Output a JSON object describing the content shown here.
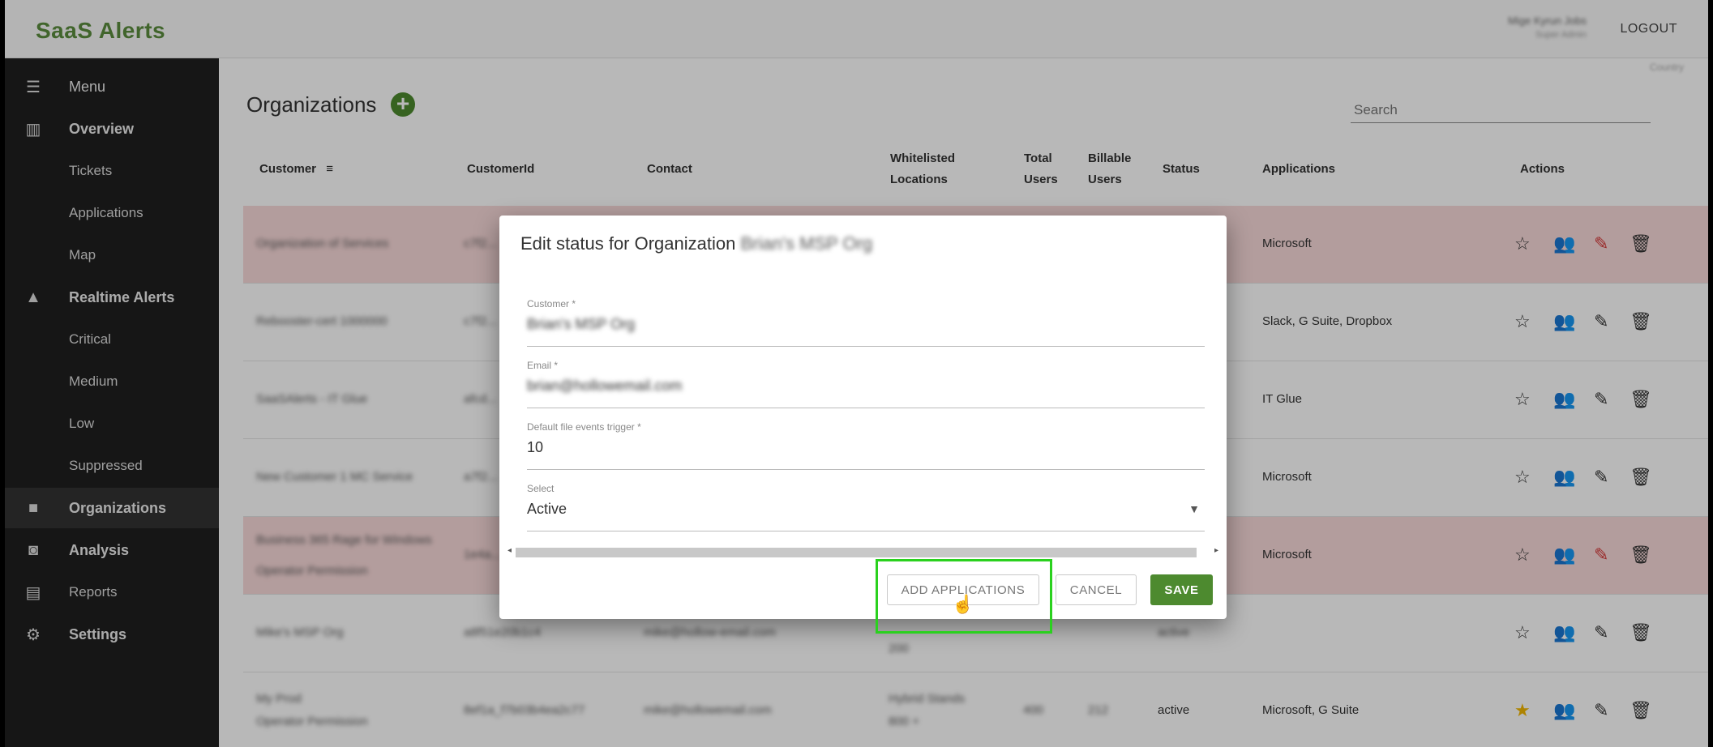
{
  "app": {
    "logo_text": "SaaS Alerts",
    "user_name": "Mige Kyrun Jobs",
    "user_sub": "Super Admin",
    "logout": "LOGOUT"
  },
  "sidebar": {
    "items": [
      {
        "label": "Menu",
        "icon": "menu-icon"
      },
      {
        "label": "Overview",
        "icon": "chart-icon"
      },
      {
        "label": "Tickets"
      },
      {
        "label": "Applications"
      },
      {
        "label": "Map"
      },
      {
        "label": "Realtime Alerts",
        "icon": "warning-icon"
      },
      {
        "label": "Critical"
      },
      {
        "label": "Medium"
      },
      {
        "label": "Low"
      },
      {
        "label": "Suppressed"
      },
      {
        "label": "Organizations",
        "icon": "briefcase-icon"
      },
      {
        "label": "Analysis",
        "icon": "analysis-icon"
      },
      {
        "label": "Reports",
        "icon": "reports-icon"
      },
      {
        "label": "Settings",
        "icon": "settings-icon"
      }
    ]
  },
  "main": {
    "title": "Organizations",
    "search_placeholder": "Search",
    "scroll_hint": "Country",
    "columns": [
      "Customer",
      "CustomerId",
      "Contact",
      "Whitelisted",
      "Locations",
      "Total",
      "Users",
      "Billable",
      "Users",
      "Status",
      "Applications",
      "Actions"
    ],
    "rows": [
      {
        "customer": "Organization of Services",
        "id": "c7f2...",
        "contact": "",
        "applications": "Microsoft",
        "status": ""
      },
      {
        "customer": "Rebooster-cert 1000000",
        "id": "c7f2...",
        "contact": "",
        "applications": "Slack, G Suite, Dropbox",
        "status": ""
      },
      {
        "customer": "SaaSAlerts - IT Glue",
        "id": "afcd...",
        "contact": "",
        "applications": "IT Glue",
        "status": ""
      },
      {
        "customer": "New Customer 1 MC Service",
        "id": "a7f2...",
        "contact": "",
        "applications": "Microsoft",
        "status": ""
      },
      {
        "customer": "Business 365 Rage for Windows",
        "customer2": "Operator Permission",
        "id": "1e4a...",
        "contact": "",
        "applications": "Microsoft",
        "status": ""
      },
      {
        "customer": "Mike's MSP Org",
        "id": "a8f51e20b1c4",
        "contact": "mike@hollow-email.com",
        "applications": "",
        "status": "active",
        "loc": "200"
      },
      {
        "customer": "My Prod",
        "customer2": "Operator Permission",
        "id": "8ef1a_f7b03b4ea2c77",
        "contact": "mike@hollowemail.com",
        "loc": "Hybrid Stands",
        "loc2": "800 +",
        "total": "400",
        "billable": "212",
        "status": "active",
        "applications": "Microsoft, G Suite"
      }
    ]
  },
  "modal": {
    "title_prefix": "Edit status for Organization",
    "org_name": "Brian's MSP Org",
    "fields": [
      {
        "label": "Customer *",
        "value": "Brian's MSP Org"
      },
      {
        "label": "Email *",
        "value": "brian@hollowemail.com"
      },
      {
        "label": "Default file events trigger *",
        "value": "10"
      },
      {
        "label": "Select",
        "value": "Active"
      }
    ],
    "buttons": {
      "add_applications": "ADD APPLICATIONS",
      "cancel": "CANCEL",
      "save": "SAVE"
    }
  },
  "colors": {
    "brand_green": "#4d8a2f",
    "highlight": "#2ad11e",
    "sidebar_bg": "#1f1f1f",
    "pink_row": "#f9dada"
  }
}
